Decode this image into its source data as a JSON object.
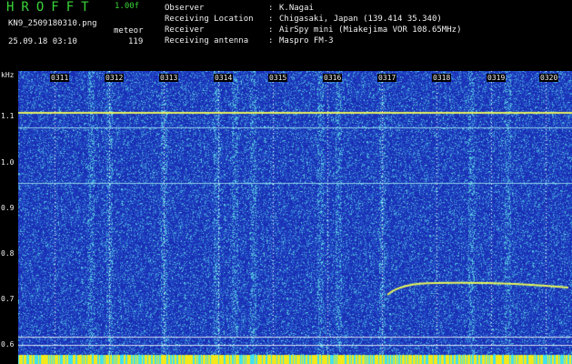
{
  "header": {
    "app_title": "HROFFT",
    "version": "1.00f",
    "filename": "KN9_2509180310.png",
    "datetime": "25.09.18 03:10",
    "detect_label": "meteor",
    "detect_count": "119"
  },
  "info": [
    {
      "key": "Observer",
      "value": "K.Nagai"
    },
    {
      "key": "Receiving Location",
      "value": "Chigasaki, Japan (139.414 35.340)"
    },
    {
      "key": "Receiver",
      "value": "AirSpy mini (Miakejima VOR 108.65MHz)"
    },
    {
      "key": "Receiving antenna",
      "value": "Maspro FM-3"
    }
  ],
  "spectrogram": {
    "y_unit": "kHz",
    "y_ticks": [
      "1.1",
      "1.0",
      "0.9",
      "0.8",
      "0.7",
      "0.6"
    ],
    "x_ticks": [
      "0311",
      "0312",
      "0313",
      "0314",
      "0315",
      "0316",
      "0317",
      "0318",
      "0319",
      "0320"
    ],
    "freq_range_khz": [
      0.57,
      1.18
    ],
    "colors": {
      "background": "#000000",
      "base": "#1c31b8",
      "noise_hi": "#3fa7d6",
      "signal": "#e8f85a",
      "bottom_bar": "#f2e81a"
    }
  }
}
